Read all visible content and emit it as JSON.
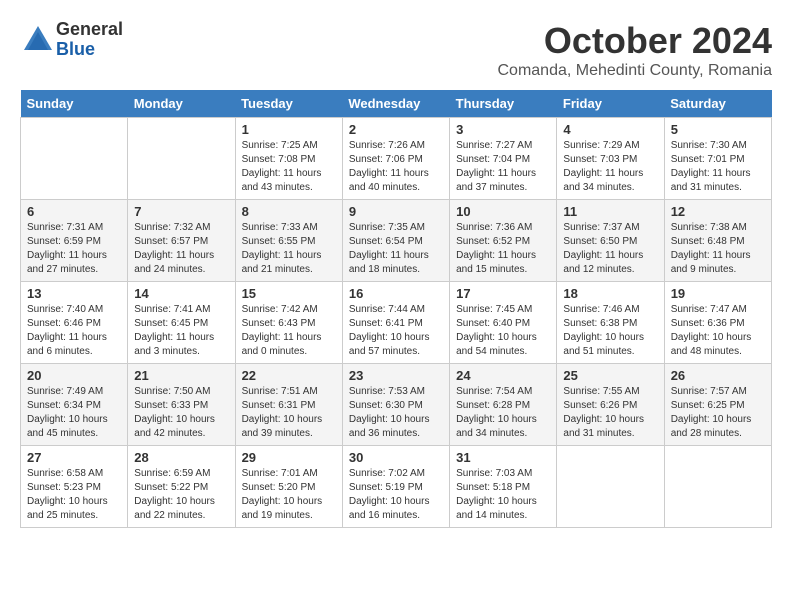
{
  "header": {
    "logo_general": "General",
    "logo_blue": "Blue",
    "month_title": "October 2024",
    "location": "Comanda, Mehedinti County, Romania"
  },
  "days_of_week": [
    "Sunday",
    "Monday",
    "Tuesday",
    "Wednesday",
    "Thursday",
    "Friday",
    "Saturday"
  ],
  "weeks": [
    [
      {
        "day": "",
        "sunrise": "",
        "sunset": "",
        "daylight": ""
      },
      {
        "day": "",
        "sunrise": "",
        "sunset": "",
        "daylight": ""
      },
      {
        "day": "1",
        "sunrise": "Sunrise: 7:25 AM",
        "sunset": "Sunset: 7:08 PM",
        "daylight": "Daylight: 11 hours and 43 minutes."
      },
      {
        "day": "2",
        "sunrise": "Sunrise: 7:26 AM",
        "sunset": "Sunset: 7:06 PM",
        "daylight": "Daylight: 11 hours and 40 minutes."
      },
      {
        "day": "3",
        "sunrise": "Sunrise: 7:27 AM",
        "sunset": "Sunset: 7:04 PM",
        "daylight": "Daylight: 11 hours and 37 minutes."
      },
      {
        "day": "4",
        "sunrise": "Sunrise: 7:29 AM",
        "sunset": "Sunset: 7:03 PM",
        "daylight": "Daylight: 11 hours and 34 minutes."
      },
      {
        "day": "5",
        "sunrise": "Sunrise: 7:30 AM",
        "sunset": "Sunset: 7:01 PM",
        "daylight": "Daylight: 11 hours and 31 minutes."
      }
    ],
    [
      {
        "day": "6",
        "sunrise": "Sunrise: 7:31 AM",
        "sunset": "Sunset: 6:59 PM",
        "daylight": "Daylight: 11 hours and 27 minutes."
      },
      {
        "day": "7",
        "sunrise": "Sunrise: 7:32 AM",
        "sunset": "Sunset: 6:57 PM",
        "daylight": "Daylight: 11 hours and 24 minutes."
      },
      {
        "day": "8",
        "sunrise": "Sunrise: 7:33 AM",
        "sunset": "Sunset: 6:55 PM",
        "daylight": "Daylight: 11 hours and 21 minutes."
      },
      {
        "day": "9",
        "sunrise": "Sunrise: 7:35 AM",
        "sunset": "Sunset: 6:54 PM",
        "daylight": "Daylight: 11 hours and 18 minutes."
      },
      {
        "day": "10",
        "sunrise": "Sunrise: 7:36 AM",
        "sunset": "Sunset: 6:52 PM",
        "daylight": "Daylight: 11 hours and 15 minutes."
      },
      {
        "day": "11",
        "sunrise": "Sunrise: 7:37 AM",
        "sunset": "Sunset: 6:50 PM",
        "daylight": "Daylight: 11 hours and 12 minutes."
      },
      {
        "day": "12",
        "sunrise": "Sunrise: 7:38 AM",
        "sunset": "Sunset: 6:48 PM",
        "daylight": "Daylight: 11 hours and 9 minutes."
      }
    ],
    [
      {
        "day": "13",
        "sunrise": "Sunrise: 7:40 AM",
        "sunset": "Sunset: 6:46 PM",
        "daylight": "Daylight: 11 hours and 6 minutes."
      },
      {
        "day": "14",
        "sunrise": "Sunrise: 7:41 AM",
        "sunset": "Sunset: 6:45 PM",
        "daylight": "Daylight: 11 hours and 3 minutes."
      },
      {
        "day": "15",
        "sunrise": "Sunrise: 7:42 AM",
        "sunset": "Sunset: 6:43 PM",
        "daylight": "Daylight: 11 hours and 0 minutes."
      },
      {
        "day": "16",
        "sunrise": "Sunrise: 7:44 AM",
        "sunset": "Sunset: 6:41 PM",
        "daylight": "Daylight: 10 hours and 57 minutes."
      },
      {
        "day": "17",
        "sunrise": "Sunrise: 7:45 AM",
        "sunset": "Sunset: 6:40 PM",
        "daylight": "Daylight: 10 hours and 54 minutes."
      },
      {
        "day": "18",
        "sunrise": "Sunrise: 7:46 AM",
        "sunset": "Sunset: 6:38 PM",
        "daylight": "Daylight: 10 hours and 51 minutes."
      },
      {
        "day": "19",
        "sunrise": "Sunrise: 7:47 AM",
        "sunset": "Sunset: 6:36 PM",
        "daylight": "Daylight: 10 hours and 48 minutes."
      }
    ],
    [
      {
        "day": "20",
        "sunrise": "Sunrise: 7:49 AM",
        "sunset": "Sunset: 6:34 PM",
        "daylight": "Daylight: 10 hours and 45 minutes."
      },
      {
        "day": "21",
        "sunrise": "Sunrise: 7:50 AM",
        "sunset": "Sunset: 6:33 PM",
        "daylight": "Daylight: 10 hours and 42 minutes."
      },
      {
        "day": "22",
        "sunrise": "Sunrise: 7:51 AM",
        "sunset": "Sunset: 6:31 PM",
        "daylight": "Daylight: 10 hours and 39 minutes."
      },
      {
        "day": "23",
        "sunrise": "Sunrise: 7:53 AM",
        "sunset": "Sunset: 6:30 PM",
        "daylight": "Daylight: 10 hours and 36 minutes."
      },
      {
        "day": "24",
        "sunrise": "Sunrise: 7:54 AM",
        "sunset": "Sunset: 6:28 PM",
        "daylight": "Daylight: 10 hours and 34 minutes."
      },
      {
        "day": "25",
        "sunrise": "Sunrise: 7:55 AM",
        "sunset": "Sunset: 6:26 PM",
        "daylight": "Daylight: 10 hours and 31 minutes."
      },
      {
        "day": "26",
        "sunrise": "Sunrise: 7:57 AM",
        "sunset": "Sunset: 6:25 PM",
        "daylight": "Daylight: 10 hours and 28 minutes."
      }
    ],
    [
      {
        "day": "27",
        "sunrise": "Sunrise: 6:58 AM",
        "sunset": "Sunset: 5:23 PM",
        "daylight": "Daylight: 10 hours and 25 minutes."
      },
      {
        "day": "28",
        "sunrise": "Sunrise: 6:59 AM",
        "sunset": "Sunset: 5:22 PM",
        "daylight": "Daylight: 10 hours and 22 minutes."
      },
      {
        "day": "29",
        "sunrise": "Sunrise: 7:01 AM",
        "sunset": "Sunset: 5:20 PM",
        "daylight": "Daylight: 10 hours and 19 minutes."
      },
      {
        "day": "30",
        "sunrise": "Sunrise: 7:02 AM",
        "sunset": "Sunset: 5:19 PM",
        "daylight": "Daylight: 10 hours and 16 minutes."
      },
      {
        "day": "31",
        "sunrise": "Sunrise: 7:03 AM",
        "sunset": "Sunset: 5:18 PM",
        "daylight": "Daylight: 10 hours and 14 minutes."
      },
      {
        "day": "",
        "sunrise": "",
        "sunset": "",
        "daylight": ""
      },
      {
        "day": "",
        "sunrise": "",
        "sunset": "",
        "daylight": ""
      }
    ]
  ]
}
